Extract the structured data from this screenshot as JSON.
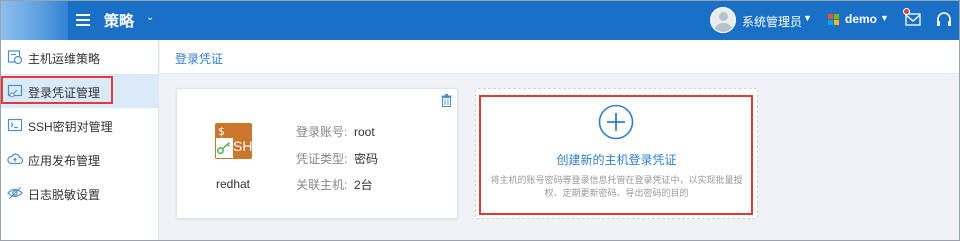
{
  "header": {
    "menu_title": "策略",
    "user_name": "系统管理员",
    "tenant_name": "demo",
    "colors": {
      "topbar": "#1a70c6",
      "accent": "#2f7fd0",
      "highlight": "#e53935"
    }
  },
  "sidebar": {
    "items": [
      {
        "label": "主机运维策略",
        "icon": "policy-icon"
      },
      {
        "label": "登录凭证管理",
        "icon": "credential-icon",
        "active": true
      },
      {
        "label": "SSH密钥对管理",
        "icon": "ssh-key-icon"
      },
      {
        "label": "应用发布管理",
        "icon": "cloud-icon"
      },
      {
        "label": "日志脱敏设置",
        "icon": "eye-icon"
      }
    ]
  },
  "main": {
    "breadcrumb": "登录凭证",
    "credential_card": {
      "host_name": "redhat",
      "fields": [
        {
          "key": "登录账号:",
          "value": "root"
        },
        {
          "key": "凭证类型:",
          "value": "密码"
        },
        {
          "key": "关联主机:",
          "value": "2台"
        }
      ],
      "logo_text_top": "$_",
      "logo_text_bottom": "SH"
    },
    "create_card": {
      "label": "创建新的主机登录凭证",
      "description": "将主机的账号密码等登录信息托管在登录凭证中，以实现批量授权、定期更新密码、导出密码的目的"
    }
  }
}
